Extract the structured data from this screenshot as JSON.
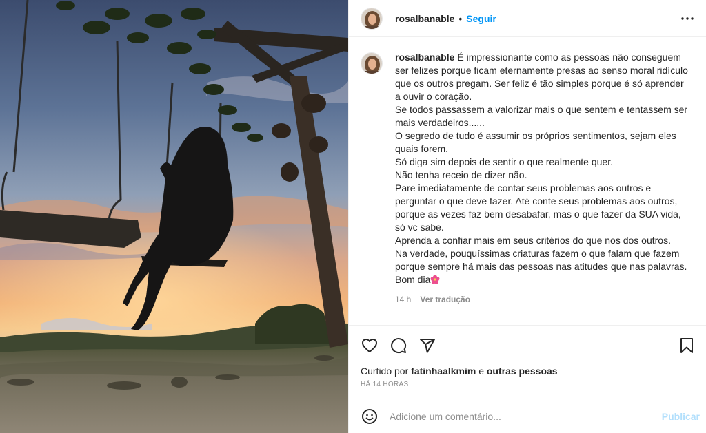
{
  "post": {
    "username": "rosalbanable",
    "follow_label": "Seguir",
    "separator": "•",
    "more_icon": "more-horizontal-icon"
  },
  "caption": {
    "username": "rosalbanable",
    "lines": [
      "É impressionante como as pessoas não conseguem ser felizes porque ficam eternamente presas ao senso moral ridículo que os outros pregam. Ser feliz é tão simples porque é só aprender a ouvir o coração.",
      "Se todos passassem a valorizar mais o que sentem e tentassem ser mais verdadeiros......",
      "O segredo de tudo é assumir os próprios sentimentos, sejam eles quais forem.",
      "Só diga sim depois de sentir o que realmente quer.",
      "Não tenha receio de dizer não.",
      "Pare imediatamente de contar seus problemas aos outros e perguntar o que deve fazer. Até conte seus problemas aos outros, porque as vezes faz bem desabafar, mas o que fazer da SUA vida, só vc sabe.",
      "Aprenda a confiar mais em seus critérios do que nos dos outros.",
      "Na verdade, pouquíssimas criaturas fazem o que falam que fazem porque sempre há mais das pessoas nas atitudes que nas palavras.",
      "Bom dia"
    ],
    "emoji_icon": "hibiscus-flower-icon",
    "age": "14 h",
    "translate_label": "Ver tradução"
  },
  "actions": {
    "icons": [
      "heart-icon",
      "comment-icon",
      "share-icon",
      "bookmark-icon"
    ]
  },
  "likes": {
    "prefix": "Curtido por",
    "user": "fatinhaalkmim",
    "conjunction": "e",
    "others": "outras pessoas"
  },
  "timestamp": "HÁ 14 HORAS",
  "comment": {
    "placeholder": "Adicione um comentário...",
    "publish_label": "Publicar",
    "emoji_icon": "smiley-icon"
  },
  "colors": {
    "accent": "#0095f6",
    "publish_disabled": "#b2dffc",
    "muted": "#8e8e8e",
    "text": "#262626",
    "border": "#efefef"
  }
}
